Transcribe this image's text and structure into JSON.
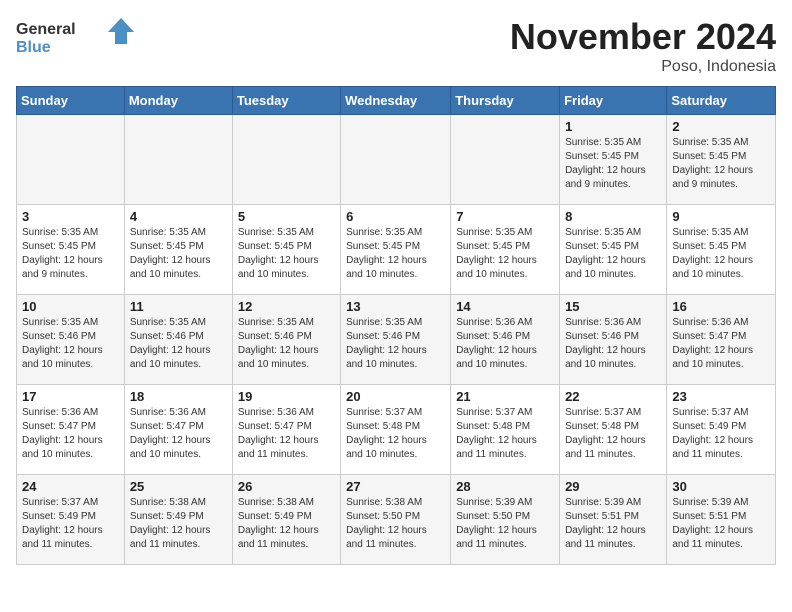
{
  "header": {
    "logo_general": "General",
    "logo_blue": "Blue",
    "title": "November 2024",
    "location": "Poso, Indonesia"
  },
  "weekdays": [
    "Sunday",
    "Monday",
    "Tuesday",
    "Wednesday",
    "Thursday",
    "Friday",
    "Saturday"
  ],
  "weeks": [
    [
      {
        "day": "",
        "info": ""
      },
      {
        "day": "",
        "info": ""
      },
      {
        "day": "",
        "info": ""
      },
      {
        "day": "",
        "info": ""
      },
      {
        "day": "",
        "info": ""
      },
      {
        "day": "1",
        "info": "Sunrise: 5:35 AM\nSunset: 5:45 PM\nDaylight: 12 hours\nand 9 minutes."
      },
      {
        "day": "2",
        "info": "Sunrise: 5:35 AM\nSunset: 5:45 PM\nDaylight: 12 hours\nand 9 minutes."
      }
    ],
    [
      {
        "day": "3",
        "info": "Sunrise: 5:35 AM\nSunset: 5:45 PM\nDaylight: 12 hours\nand 9 minutes."
      },
      {
        "day": "4",
        "info": "Sunrise: 5:35 AM\nSunset: 5:45 PM\nDaylight: 12 hours\nand 10 minutes."
      },
      {
        "day": "5",
        "info": "Sunrise: 5:35 AM\nSunset: 5:45 PM\nDaylight: 12 hours\nand 10 minutes."
      },
      {
        "day": "6",
        "info": "Sunrise: 5:35 AM\nSunset: 5:45 PM\nDaylight: 12 hours\nand 10 minutes."
      },
      {
        "day": "7",
        "info": "Sunrise: 5:35 AM\nSunset: 5:45 PM\nDaylight: 12 hours\nand 10 minutes."
      },
      {
        "day": "8",
        "info": "Sunrise: 5:35 AM\nSunset: 5:45 PM\nDaylight: 12 hours\nand 10 minutes."
      },
      {
        "day": "9",
        "info": "Sunrise: 5:35 AM\nSunset: 5:45 PM\nDaylight: 12 hours\nand 10 minutes."
      }
    ],
    [
      {
        "day": "10",
        "info": "Sunrise: 5:35 AM\nSunset: 5:46 PM\nDaylight: 12 hours\nand 10 minutes."
      },
      {
        "day": "11",
        "info": "Sunrise: 5:35 AM\nSunset: 5:46 PM\nDaylight: 12 hours\nand 10 minutes."
      },
      {
        "day": "12",
        "info": "Sunrise: 5:35 AM\nSunset: 5:46 PM\nDaylight: 12 hours\nand 10 minutes."
      },
      {
        "day": "13",
        "info": "Sunrise: 5:35 AM\nSunset: 5:46 PM\nDaylight: 12 hours\nand 10 minutes."
      },
      {
        "day": "14",
        "info": "Sunrise: 5:36 AM\nSunset: 5:46 PM\nDaylight: 12 hours\nand 10 minutes."
      },
      {
        "day": "15",
        "info": "Sunrise: 5:36 AM\nSunset: 5:46 PM\nDaylight: 12 hours\nand 10 minutes."
      },
      {
        "day": "16",
        "info": "Sunrise: 5:36 AM\nSunset: 5:47 PM\nDaylight: 12 hours\nand 10 minutes."
      }
    ],
    [
      {
        "day": "17",
        "info": "Sunrise: 5:36 AM\nSunset: 5:47 PM\nDaylight: 12 hours\nand 10 minutes."
      },
      {
        "day": "18",
        "info": "Sunrise: 5:36 AM\nSunset: 5:47 PM\nDaylight: 12 hours\nand 10 minutes."
      },
      {
        "day": "19",
        "info": "Sunrise: 5:36 AM\nSunset: 5:47 PM\nDaylight: 12 hours\nand 11 minutes."
      },
      {
        "day": "20",
        "info": "Sunrise: 5:37 AM\nSunset: 5:48 PM\nDaylight: 12 hours\nand 10 minutes."
      },
      {
        "day": "21",
        "info": "Sunrise: 5:37 AM\nSunset: 5:48 PM\nDaylight: 12 hours\nand 11 minutes."
      },
      {
        "day": "22",
        "info": "Sunrise: 5:37 AM\nSunset: 5:48 PM\nDaylight: 12 hours\nand 11 minutes."
      },
      {
        "day": "23",
        "info": "Sunrise: 5:37 AM\nSunset: 5:49 PM\nDaylight: 12 hours\nand 11 minutes."
      }
    ],
    [
      {
        "day": "24",
        "info": "Sunrise: 5:37 AM\nSunset: 5:49 PM\nDaylight: 12 hours\nand 11 minutes."
      },
      {
        "day": "25",
        "info": "Sunrise: 5:38 AM\nSunset: 5:49 PM\nDaylight: 12 hours\nand 11 minutes."
      },
      {
        "day": "26",
        "info": "Sunrise: 5:38 AM\nSunset: 5:49 PM\nDaylight: 12 hours\nand 11 minutes."
      },
      {
        "day": "27",
        "info": "Sunrise: 5:38 AM\nSunset: 5:50 PM\nDaylight: 12 hours\nand 11 minutes."
      },
      {
        "day": "28",
        "info": "Sunrise: 5:39 AM\nSunset: 5:50 PM\nDaylight: 12 hours\nand 11 minutes."
      },
      {
        "day": "29",
        "info": "Sunrise: 5:39 AM\nSunset: 5:51 PM\nDaylight: 12 hours\nand 11 minutes."
      },
      {
        "day": "30",
        "info": "Sunrise: 5:39 AM\nSunset: 5:51 PM\nDaylight: 12 hours\nand 11 minutes."
      }
    ]
  ]
}
